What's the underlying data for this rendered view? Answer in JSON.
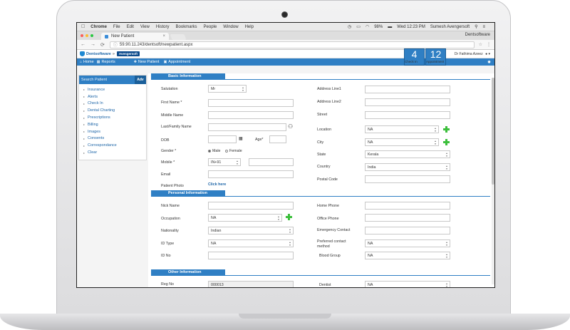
{
  "menubar": {
    "app": "Chrome",
    "items": [
      "File",
      "Edit",
      "View",
      "History",
      "Bookmarks",
      "People",
      "Window",
      "Help"
    ],
    "battery": "98%",
    "clock": "Wed 12:23 PM",
    "user": "Sumesh Avengersoft"
  },
  "browser": {
    "tab_title": "New Patient",
    "tab_close": "×",
    "profile": "Dentsoftware",
    "url": "59.90.11.243/dentsoft/newpatient.aspx"
  },
  "app": {
    "logo": "Dentsoftware",
    "separator": "»",
    "org": "Avengersoft",
    "user": "Dr Fathima Azeez"
  },
  "nav": {
    "home": "Home",
    "reports": "Reports",
    "new_patient": "New Patient",
    "appointment": "Appointment"
  },
  "counters": {
    "checkin_value": "4",
    "checkin_label": "Check In",
    "appointment_value": "12",
    "appointment_label": "Appointment"
  },
  "sidebar": {
    "search_placeholder": "Search Patient",
    "adv": "Adv",
    "items": [
      "Insurance",
      "Alerts",
      "Check In",
      "Dental Charting",
      "Prescriptions",
      "Billing",
      "Images",
      "Consents",
      "Correspondance",
      "Clear"
    ]
  },
  "sections": {
    "basic": "Basic Information",
    "personal": "Personal Information",
    "other": "Other Information"
  },
  "basic": {
    "salutation_label": "Salutation",
    "salutation_value": "Mr",
    "first_name_label": "First Name *",
    "middle_name_label": "Middle Name",
    "last_name_label": "Last/Family Name",
    "dob_label": "DOB",
    "age_label": "Age*",
    "gender_label": "Gender *",
    "gender_male": "Male",
    "gender_female": "Female",
    "mobile_label": "Mobile *",
    "mobile_code": "IN+91",
    "email_label": "Email",
    "photo_label": "Patient Photo",
    "photo_link": "Click here",
    "address1_label": "Address Line1",
    "address2_label": "Address Line2",
    "street_label": "Street",
    "location_label": "Location",
    "location_value": "NA",
    "city_label": "City",
    "city_value": "NA",
    "state_label": "State",
    "state_value": "Kerala",
    "country_label": "Country",
    "country_value": "India",
    "postal_label": "Postal Code"
  },
  "personal": {
    "nick_label": "Nick Name",
    "occupation_label": "Occupation",
    "occupation_value": "NA",
    "nationality_label": "Nationality",
    "nationality_value": "Indian",
    "idtype_label": "ID Type",
    "idtype_value": "NA",
    "idno_label": "ID No",
    "home_phone_label": "Home Phone",
    "office_phone_label": "Office Phone",
    "emergency_label": "Emergency Contact",
    "preferred_label_1": "Preferred contact",
    "preferred_label_2": "method",
    "preferred_value": "NA",
    "blood_label": "Blood Group",
    "blood_value": "NA"
  },
  "other": {
    "reg_label": "Reg No",
    "reg_value": "000013",
    "dentist_label": "Dentist",
    "dentist_value": "NA"
  }
}
